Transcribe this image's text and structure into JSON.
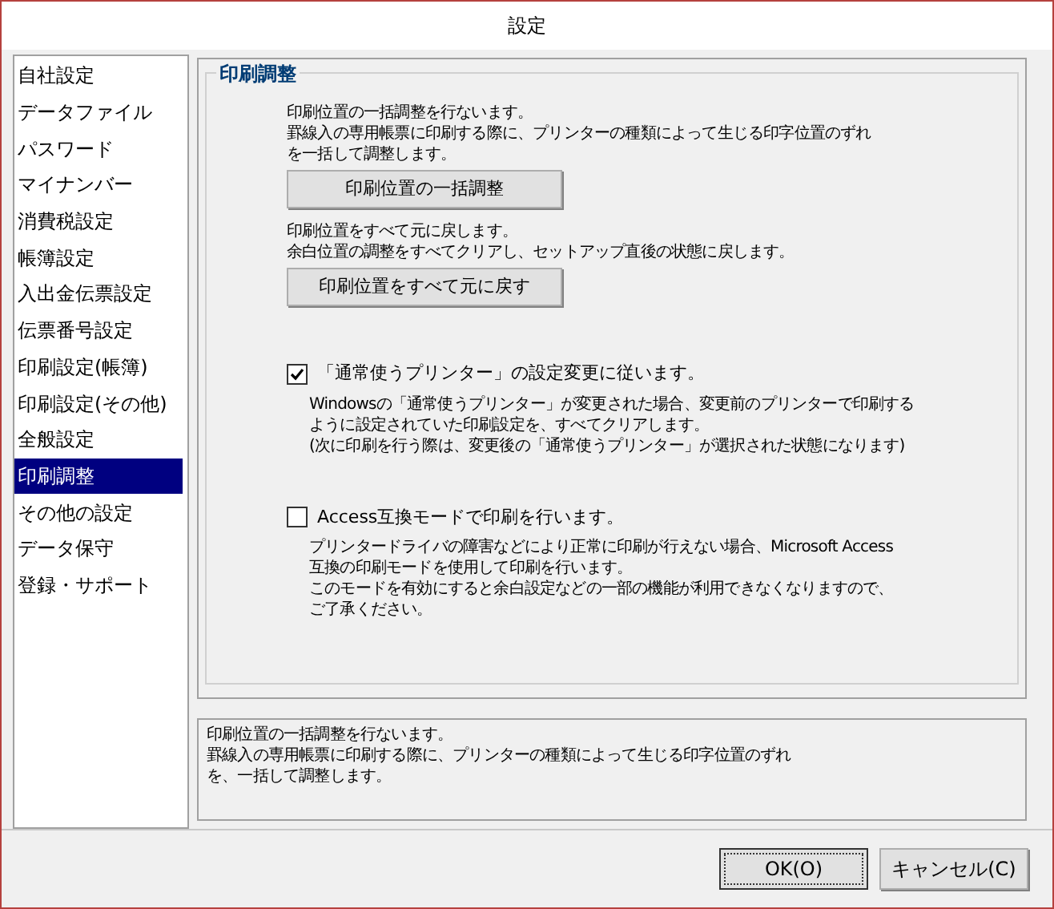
{
  "window": {
    "title": "設定"
  },
  "sidebar": {
    "items": [
      {
        "label": "自社設定",
        "selected": false
      },
      {
        "label": "データファイル",
        "selected": false
      },
      {
        "label": "パスワード",
        "selected": false
      },
      {
        "label": "マイナンバー",
        "selected": false
      },
      {
        "label": "消費税設定",
        "selected": false
      },
      {
        "label": "帳簿設定",
        "selected": false
      },
      {
        "label": "入出金伝票設定",
        "selected": false
      },
      {
        "label": "伝票番号設定",
        "selected": false
      },
      {
        "label": "印刷設定(帳簿)",
        "selected": false
      },
      {
        "label": "印刷設定(その他)",
        "selected": false
      },
      {
        "label": "全般設定",
        "selected": false
      },
      {
        "label": "印刷調整",
        "selected": true
      },
      {
        "label": "その他の設定",
        "selected": false
      },
      {
        "label": "データ保守",
        "selected": false
      },
      {
        "label": "登録・サポート",
        "selected": false
      }
    ]
  },
  "group": {
    "title": "印刷調整",
    "sections": [
      {
        "kind": "button",
        "lines": [
          "印刷位置の一括調整を行ないます。",
          "罫線入の専用帳票に印刷する際に、プリンターの種類によって生じる印字位置のずれ",
          "を一括して調整します。"
        ],
        "button": "印刷位置の一括調整"
      },
      {
        "kind": "button",
        "lines": [
          "印刷位置をすべて元に戻します。",
          "余白位置の調整をすべてクリアし、セットアップ直後の状態に戻します。"
        ],
        "button": "印刷位置をすべて元に戻す"
      },
      {
        "kind": "checkbox",
        "label": "「通常使うプリンター」の設定変更に従います。",
        "checked": true,
        "lines": [
          "Windowsの「通常使うプリンター」が変更された場合、変更前のプリンターで印刷する",
          "ように設定されていた印刷設定を、すべてクリアします。",
          "(次に印刷を行う際は、変更後の「通常使うプリンター」が選択された状態になります)"
        ]
      },
      {
        "kind": "checkbox",
        "label": "Access互換モードで印刷を行います。",
        "checked": false,
        "lines": [
          "プリンタードライバの障害などにより正常に印刷が行えない場合、Microsoft Access",
          "互換の印刷モードを使用して印刷を行います。",
          "このモードを有効にすると余白設定などの一部の機能が利用できなくなりますので、",
          "ご了承ください。"
        ]
      }
    ]
  },
  "description": [
    "印刷位置の一括調整を行ないます。",
    "罫線入の専用帳票に印刷する際に、プリンターの種類によって生じる印字位置のずれ",
    "を、一括して調整します。"
  ],
  "buttons": [
    {
      "label": "OK(O)",
      "kind": "default"
    },
    {
      "label": "キャンセル(C)",
      "kind": "normal"
    }
  ]
}
